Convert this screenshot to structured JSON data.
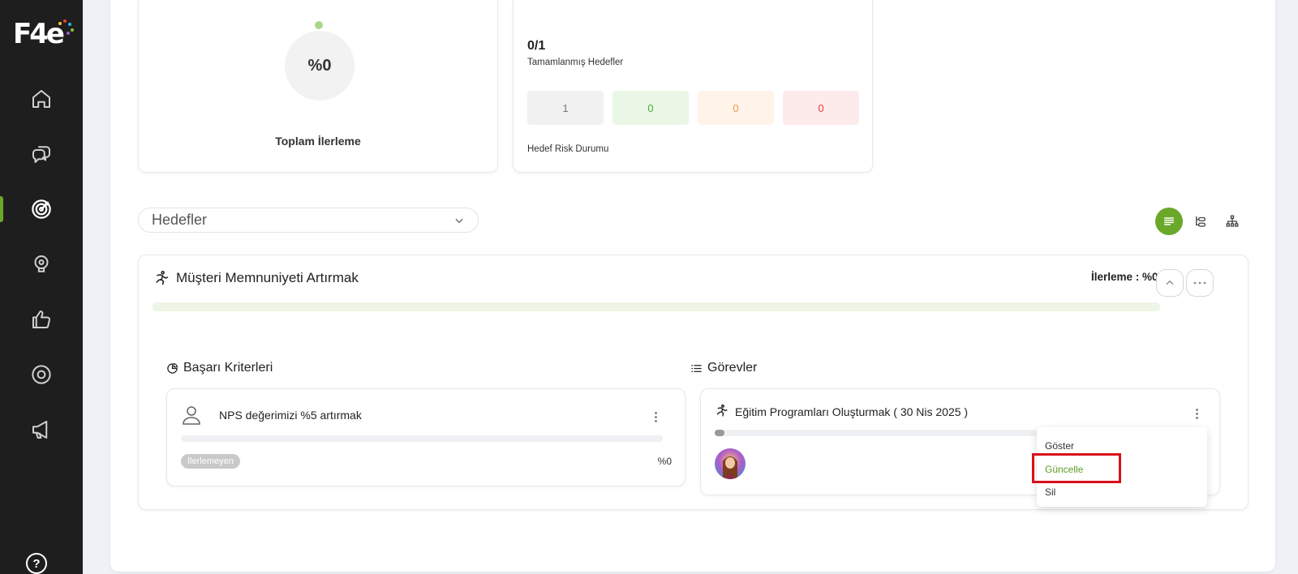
{
  "brand": {
    "logo_text": "F4e",
    "accent_color": "#6aa82a"
  },
  "sidebar": {
    "items": [
      {
        "name": "home",
        "icon": "home-icon",
        "active": false
      },
      {
        "name": "chat",
        "icon": "chat-bubbles-icon",
        "active": false
      },
      {
        "name": "goals",
        "icon": "target-icon",
        "active": true
      },
      {
        "name": "ideas",
        "icon": "lightbulb-icon",
        "active": false
      },
      {
        "name": "feedback",
        "icon": "thumbs-up-icon",
        "active": false
      },
      {
        "name": "settings",
        "icon": "gear-icon",
        "active": false
      },
      {
        "name": "announcements",
        "icon": "megaphone-icon",
        "active": false
      }
    ],
    "help_label": "?"
  },
  "summary": {
    "total_progress_value": "%0",
    "total_progress_label": "Toplam İlerleme",
    "completed_goals_value": "0/1",
    "completed_goals_label": "Tamamlanmış Hedefler",
    "risk_counts": [
      {
        "value": "1",
        "color": "#777777",
        "bg": "#f1f1f1"
      },
      {
        "value": "0",
        "color": "#4cae35",
        "bg": "#eaf7e6"
      },
      {
        "value": "0",
        "color": "#e89a45",
        "bg": "#fff3ea"
      },
      {
        "value": "0",
        "color": "#e0443f",
        "bg": "#fdeaea"
      }
    ],
    "risk_label": "Hedef Risk Durumu"
  },
  "filter": {
    "selected": "Hedefler"
  },
  "views": [
    "list-view-icon",
    "tree-view-icon",
    "org-chart-icon"
  ],
  "objective": {
    "title": "Müşteri Memnuniyeti Artırmak",
    "progress_label": "İlerleme : %0",
    "progress": 0,
    "success_criteria_title": "Başarı Kriterleri",
    "tasks_title": "Görevler",
    "key_result": {
      "name": "NPS değerimizi %5 artırmak",
      "status": "İlerlemeyen",
      "percent": "%0"
    },
    "task": {
      "name": "Eğitim Programları Oluşturmak ( 30 Nis 2025 )",
      "progress": 0.03
    }
  },
  "context_menu": {
    "items": [
      "Göster",
      "Güncelle",
      "Sil"
    ]
  }
}
